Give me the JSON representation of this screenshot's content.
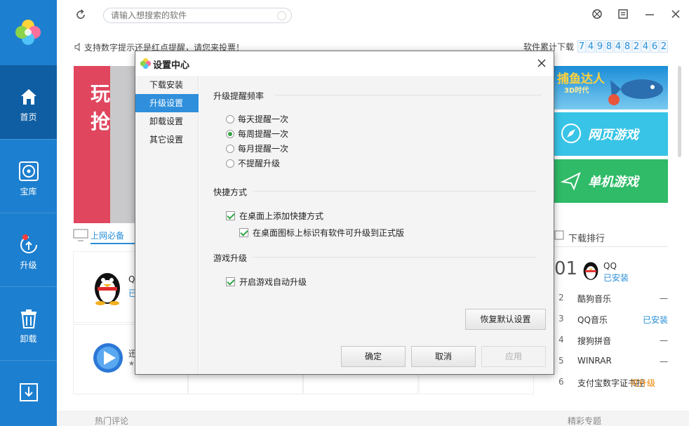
{
  "sidebar": {
    "items": [
      {
        "label": "首页",
        "icon": "home-icon"
      },
      {
        "label": "宝库",
        "icon": "disc-icon"
      },
      {
        "label": "升级",
        "icon": "upgrade-icon"
      },
      {
        "label": "卸载",
        "icon": "trash-icon"
      },
      {
        "label": "",
        "icon": "download-icon"
      }
    ]
  },
  "topbar": {
    "search_placeholder": "请输入想搜索的软件"
  },
  "notice": {
    "text": "支持数字提示还是红点提醒，请您来投票！",
    "download_label": "软件累计下载",
    "download_digits": [
      "7",
      "4",
      "9",
      "8",
      "4",
      "8",
      "2",
      "4",
      "6",
      "2"
    ]
  },
  "banner": {
    "line1": "玩",
    "line2": "抢"
  },
  "promos": {
    "game_title": "捕鱼达人",
    "game_sub": "3D时代",
    "web_games": "网页游戏",
    "pc_games": "单机游戏"
  },
  "tabs": {
    "must_have": "上网必备"
  },
  "apps": [
    {
      "name_fragment": "Q",
      "status_fragment": "已"
    },
    {
      "name_fragment": "迅",
      "status_fragment": "★"
    }
  ],
  "ranking": {
    "title": "下载排行",
    "top": {
      "rank": "01",
      "name": "QQ",
      "status": "已安装"
    },
    "rows": [
      {
        "rank": "2",
        "name": "酷狗音乐",
        "status": "一",
        "type": "none"
      },
      {
        "rank": "3",
        "name": "QQ音乐",
        "status": "已安装",
        "type": "installed"
      },
      {
        "rank": "4",
        "name": "搜狗拼音",
        "status": "一",
        "type": "none"
      },
      {
        "rank": "5",
        "name": "WINRAR",
        "status": "一",
        "type": "none"
      },
      {
        "rank": "6",
        "name": "支付宝数字证书控",
        "status": "可升级",
        "type": "available"
      }
    ]
  },
  "bottom": {
    "left": "热门评论",
    "right": "精彩专题"
  },
  "dialog": {
    "title": "设置中心",
    "nav": [
      "下载安装",
      "升级设置",
      "卸载设置",
      "其它设置"
    ],
    "active_nav": 1,
    "sections": {
      "frequency": {
        "title": "升级提醒频率",
        "options": [
          "每天提醒一次",
          "每周提醒一次",
          "每月提醒一次",
          "不提醒升级"
        ],
        "selected": 1
      },
      "shortcut": {
        "title": "快捷方式",
        "add_shortcut": "在桌面上添加快捷方式",
        "mark_icon": "在桌面图标上标识有软件可升级到正式版"
      },
      "game": {
        "title": "游戏升级",
        "auto_upgrade": "开启游戏自动升级"
      }
    },
    "buttons": {
      "restore": "恢复默认设置",
      "ok": "确定",
      "cancel": "取消",
      "apply": "应用"
    }
  }
}
